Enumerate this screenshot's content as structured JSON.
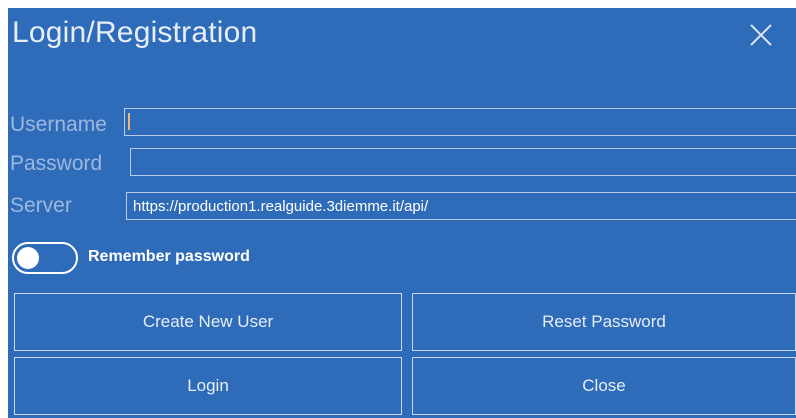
{
  "dialog": {
    "title": "Login/Registration",
    "close_icon": "close-icon"
  },
  "fields": {
    "username_label": "Username",
    "username_value": "",
    "password_label": "Password",
    "password_value": "",
    "server_label": "Server",
    "server_value": "https://production1.realguide.3diemme.it/api/"
  },
  "remember": {
    "label": "Remember password",
    "checked": false
  },
  "buttons": {
    "create_user": "Create New User",
    "reset_password": "Reset Password",
    "login": "Login",
    "close": "Close"
  },
  "colors": {
    "background": "#2e6bb8",
    "text": "#ffffff",
    "label": "#9db8de",
    "caret": "#e9b87a"
  }
}
